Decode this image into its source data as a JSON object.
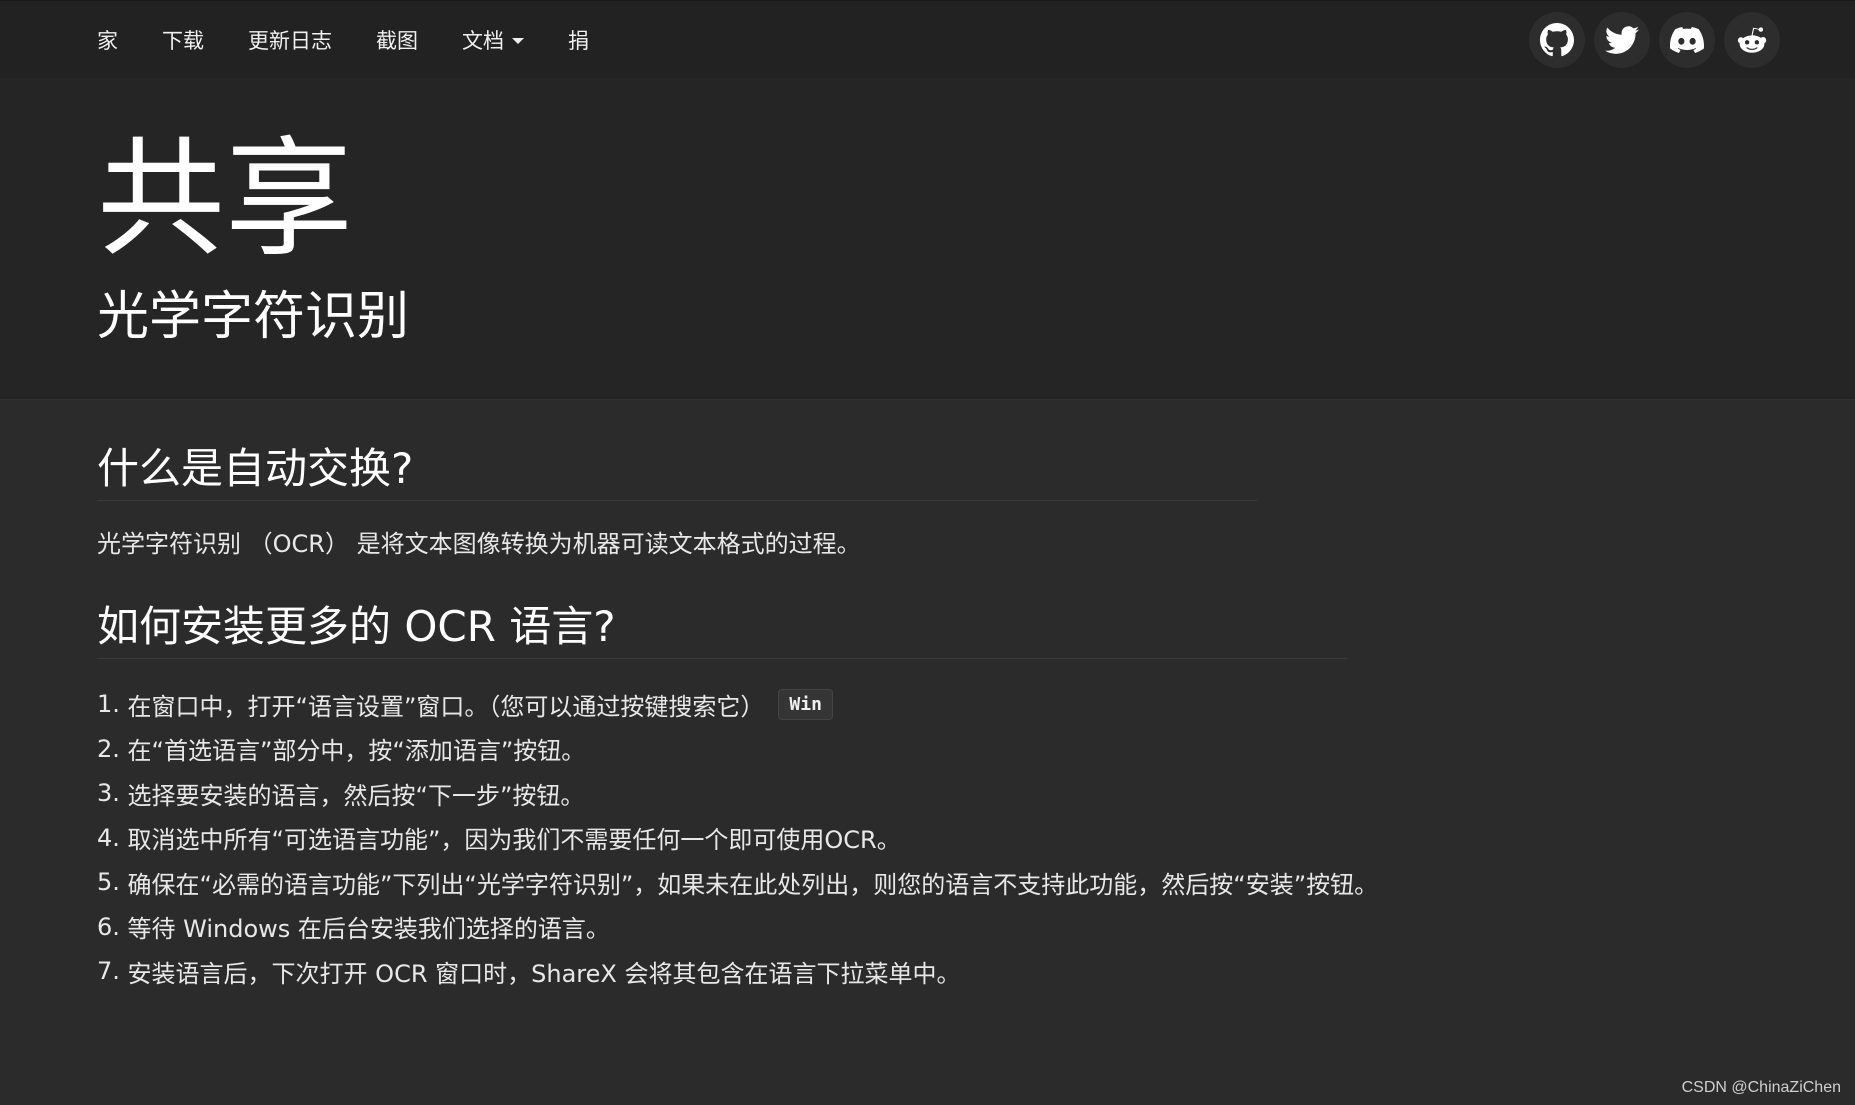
{
  "nav": {
    "items": [
      "家",
      "下载",
      "更新日志",
      "截图",
      "文档",
      "捐"
    ],
    "dropdown_index": 4,
    "socials": [
      "github-icon",
      "twitter-icon",
      "discord-icon",
      "reddit-icon"
    ]
  },
  "hero": {
    "title": "共享",
    "subtitle": "光学字符识别"
  },
  "section1": {
    "heading": "什么是自动交换?",
    "text": "光学字符识别 （OCR） 是将文本图像转换为机器可读文本格式的过程。"
  },
  "section2": {
    "heading": "如何安装更多的 OCR 语言?",
    "steps": [
      "在窗口中，打开“语言设置”窗口。（您可以通过按键搜索它）",
      "在“首选语言”部分中，按“添加语言”按钮。",
      "选择要安装的语言，然后按“下一步”按钮。",
      "取消选中所有“可选语言功能”，因为我们不需要任何一个即可使用OCR。",
      "确保在“必需的语言功能”下列出“光学字符识别”，如果未在此处列出，则您的语言不支持此功能，然后按“安装”按钮。",
      "等待 Windows 在后台安装我们选择的语言。",
      "安装语言后，下次打开 OCR 窗口时，ShareX 会将其包含在语言下拉菜单中。"
    ],
    "step_numbers": [
      "1.",
      "2.",
      "3.",
      "4.",
      "5.",
      "6.",
      "7."
    ],
    "kbd": "Win"
  },
  "watermark": "CSDN @ChinaZiChen"
}
